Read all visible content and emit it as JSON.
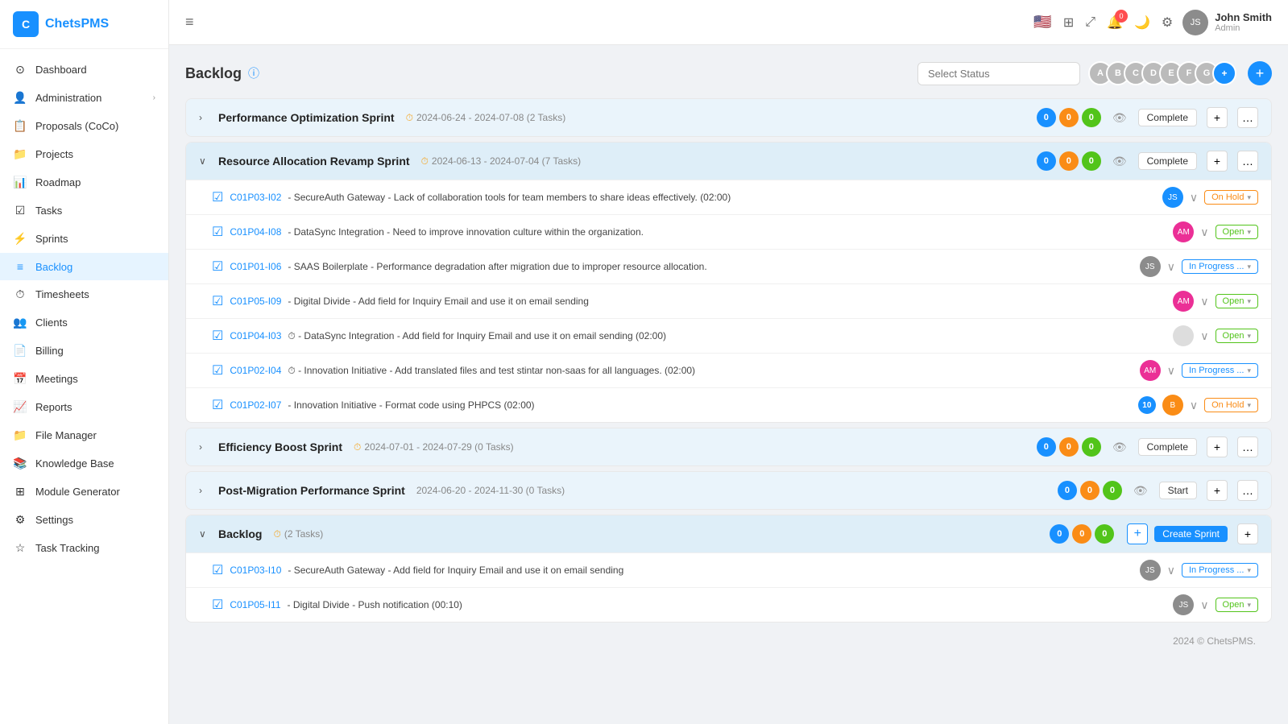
{
  "app": {
    "logo": "ChetsPMS",
    "logoShort": "C"
  },
  "header": {
    "hamburger": "≡",
    "user": {
      "name": "John Smith",
      "role": "Admin"
    },
    "notifications": "0"
  },
  "sidebar": {
    "items": [
      {
        "id": "dashboard",
        "label": "Dashboard",
        "icon": "⊙",
        "active": false
      },
      {
        "id": "administration",
        "label": "Administration",
        "icon": "👤",
        "active": false,
        "hasChevron": true
      },
      {
        "id": "proposals",
        "label": "Proposals (CoCo)",
        "icon": "📋",
        "active": false
      },
      {
        "id": "projects",
        "label": "Projects",
        "icon": "📁",
        "active": false
      },
      {
        "id": "roadmap",
        "label": "Roadmap",
        "icon": "📊",
        "active": false
      },
      {
        "id": "tasks",
        "label": "Tasks",
        "icon": "☑",
        "active": false
      },
      {
        "id": "sprints",
        "label": "Sprints",
        "icon": "⚡",
        "active": false
      },
      {
        "id": "backlog",
        "label": "Backlog",
        "icon": "≡",
        "active": true
      },
      {
        "id": "timesheets",
        "label": "Timesheets",
        "icon": "⏱",
        "active": false
      },
      {
        "id": "clients",
        "label": "Clients",
        "icon": "👥",
        "active": false
      },
      {
        "id": "billing",
        "label": "Billing",
        "icon": "📄",
        "active": false
      },
      {
        "id": "meetings",
        "label": "Meetings",
        "icon": "📅",
        "active": false
      },
      {
        "id": "reports",
        "label": "Reports",
        "icon": "📈",
        "active": false
      },
      {
        "id": "file-manager",
        "label": "File Manager",
        "icon": "📁",
        "active": false
      },
      {
        "id": "knowledge-base",
        "label": "Knowledge Base",
        "icon": "📚",
        "active": false
      },
      {
        "id": "module-generator",
        "label": "Module Generator",
        "icon": "⊞",
        "active": false
      },
      {
        "id": "settings",
        "label": "Settings",
        "icon": "⚙",
        "active": false
      },
      {
        "id": "task-tracking",
        "label": "Task Tracking",
        "icon": "☆",
        "active": false
      }
    ]
  },
  "page": {
    "title": "Backlog",
    "status_placeholder": "Select Status"
  },
  "sprints": [
    {
      "id": "sprint1",
      "name": "Performance Optimization Sprint",
      "dateIcon": "⏱",
      "dates": "2024-06-24 - 2024-07-08 (2 Tasks)",
      "expanded": false,
      "badges": [
        0,
        0,
        0
      ],
      "action": "Complete",
      "tasks": []
    },
    {
      "id": "sprint2",
      "name": "Resource Allocation Revamp Sprint",
      "dateIcon": "⏱",
      "dates": "2024-06-13 - 2024-07-04 (7 Tasks)",
      "expanded": true,
      "badges": [
        0,
        0,
        0
      ],
      "action": "Complete",
      "tasks": [
        {
          "id": "C01P03-I02",
          "title": " - SecureAuth Gateway - Lack of collaboration tools for team members to share ideas effectively. (02:00)",
          "avatarColor": "av-blue",
          "avatarText": "JS",
          "status": "On Hold",
          "statusClass": "status-onhold",
          "hasBadgeNum": false,
          "badgeNum": "",
          "hasSecondAvatar": false
        },
        {
          "id": "C01P04-I08",
          "title": " - DataSync Integration - Need to improve innovation culture within the organization.",
          "avatarColor": "av-pink",
          "avatarText": "AM",
          "status": "Open",
          "statusClass": "status-open",
          "hasBadgeNum": false,
          "badgeNum": "",
          "hasSecondAvatar": false
        },
        {
          "id": "C01P01-I06",
          "title": " - SAAS Boilerplate - Performance degradation after migration due to improper resource allocation.",
          "avatarColor": "av-gray",
          "avatarText": "JS",
          "status": "In Progress ...",
          "statusClass": "status-inprogress",
          "hasBadgeNum": false,
          "badgeNum": "",
          "hasSecondAvatar": false
        },
        {
          "id": "C01P05-I09",
          "title": " - Digital Divide - Add field for Inquiry Email and use it on email sending",
          "avatarColor": "av-pink",
          "avatarText": "AM",
          "status": "Open",
          "statusClass": "status-open",
          "hasBadgeNum": false,
          "badgeNum": "",
          "hasSecondAvatar": false
        },
        {
          "id": "C01P04-I03",
          "title": " - DataSync Integration - Add field for Inquiry Email and use it on email sending (02:00)",
          "avatarColor": "av-gray",
          "avatarText": "",
          "status": "Open",
          "statusClass": "status-open",
          "hasBadgeNum": false,
          "badgeNum": "",
          "hasSecondAvatar": false,
          "dateIcon": true
        },
        {
          "id": "C01P02-I04",
          "title": " - Innovation Initiative - Add translated files and test stintar non-saas for all languages. (02:00)",
          "avatarColor": "av-pink",
          "avatarText": "AM",
          "status": "In Progress ...",
          "statusClass": "status-inprogress",
          "hasBadgeNum": false,
          "badgeNum": "",
          "hasSecondAvatar": false,
          "dateIcon": true
        },
        {
          "id": "C01P02-I07",
          "title": " - Innovation Initiative - Format code using PHPCS (02:00)",
          "avatarColor": "av-blue",
          "avatarText": "JS",
          "status": "On Hold",
          "statusClass": "status-onhold",
          "hasBadgeNum": true,
          "badgeNum": "10",
          "hasSecondAvatar": true,
          "secondAvatarColor": "av-orange",
          "secondAvatarText": "B"
        }
      ]
    },
    {
      "id": "sprint3",
      "name": "Efficiency Boost Sprint",
      "dateIcon": "⏱",
      "dates": "2024-07-01 - 2024-07-29 (0 Tasks)",
      "expanded": false,
      "badges": [
        0,
        0,
        0
      ],
      "action": "Complete",
      "tasks": []
    },
    {
      "id": "sprint4",
      "name": "Post-Migration Performance Sprint",
      "dateIcon": "",
      "dates": "2024-06-20 - 2024-11-30 (0 Tasks)",
      "expanded": false,
      "badges": [
        0,
        0,
        0
      ],
      "action": "Start",
      "tasks": []
    }
  ],
  "backlog": {
    "label": "Backlog",
    "taskCount": "(2 Tasks)",
    "badges": [
      0,
      0,
      0
    ],
    "tasks": [
      {
        "id": "C01P03-I10",
        "title": " - SecureAuth Gateway - Add field for Inquiry Email and use it on email sending",
        "avatarColor": "av-gray",
        "avatarText": "JS",
        "status": "In Progress ...",
        "statusClass": "status-inprogress"
      },
      {
        "id": "C01P05-I11",
        "title": " - Digital Divide - Push notification (00:10)",
        "avatarColor": "av-gray",
        "avatarText": "JS",
        "status": "Open",
        "statusClass": "status-open"
      }
    ]
  },
  "footer": {
    "text": "2024 © ChetsPMS."
  },
  "avatars": [
    {
      "color": "av-red",
      "text": "A"
    },
    {
      "color": "av-orange",
      "text": "B"
    },
    {
      "color": "av-blue",
      "text": "C"
    },
    {
      "color": "av-green",
      "text": "D"
    },
    {
      "color": "av-purple",
      "text": "E"
    },
    {
      "color": "av-teal",
      "text": "F"
    },
    {
      "color": "av-gray",
      "text": "G"
    }
  ]
}
